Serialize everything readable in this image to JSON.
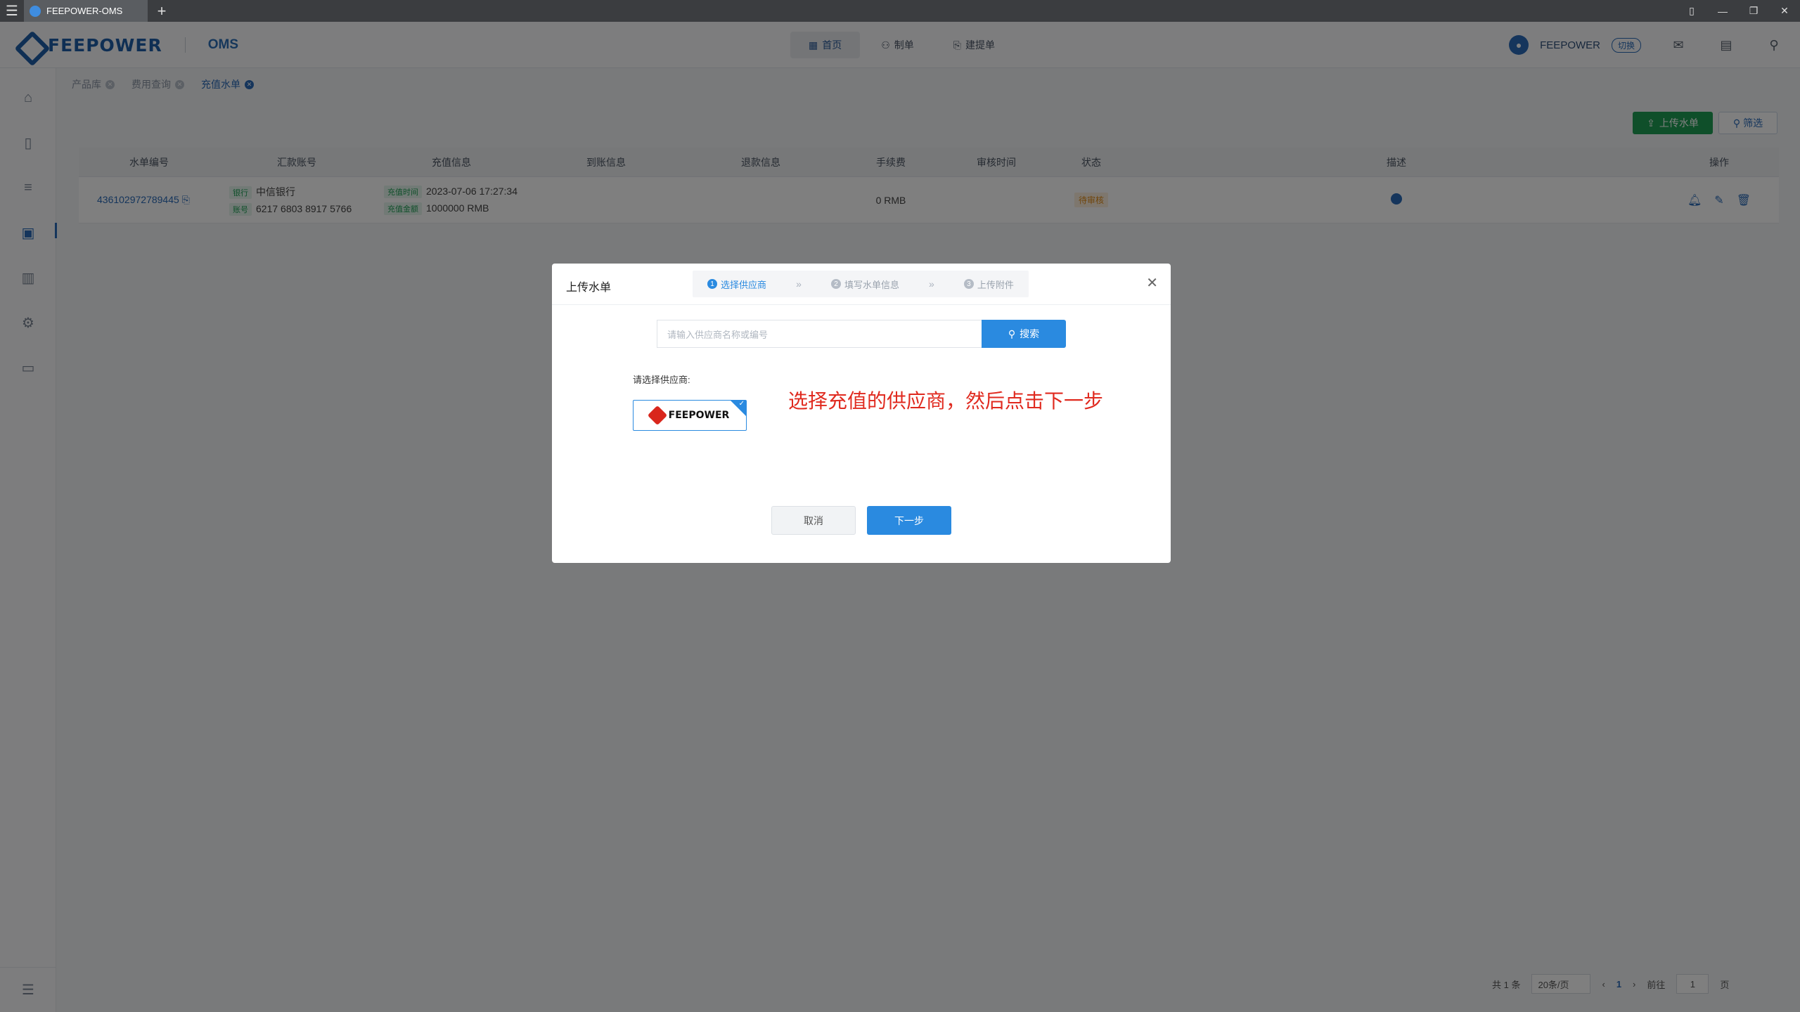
{
  "titlebar": {
    "tab_title": "FEEPOWER-OMS",
    "new_tab": "+",
    "window_controls": [
      "▯",
      "—",
      "❐",
      "✕"
    ]
  },
  "header": {
    "brand": "FEEPOWER",
    "product": "OMS",
    "nav": [
      {
        "label": "首页",
        "icon": "grid-icon",
        "active": true
      },
      {
        "label": "制单",
        "icon": "user-doc-icon",
        "active": false
      },
      {
        "label": "建提单",
        "icon": "doc-plus-icon",
        "active": false
      }
    ],
    "user_name": "FEEPOWER",
    "switch_label": "切换"
  },
  "breadcrumbs": [
    {
      "label": "产品库",
      "active": false
    },
    {
      "label": "费用查询",
      "active": false
    },
    {
      "label": "充值水单",
      "active": true
    }
  ],
  "toolbar": {
    "upload_label": "上传水单",
    "filter_label": "筛选"
  },
  "table": {
    "headers": [
      "水单编号",
      "汇款账号",
      "充值信息",
      "到账信息",
      "退款信息",
      "手续费",
      "审核时间",
      "状态",
      "描述",
      "操作"
    ],
    "rows": [
      {
        "id": "436102972789445",
        "bank_tag": "银行",
        "bank": "中信银行",
        "account_tag": "账号",
        "account": "6217 6803 8917 5766",
        "time_tag": "充值时间",
        "time": "2023-07-06 17:27:34",
        "amount_tag": "充值金额",
        "amount": "1000000 RMB",
        "fee": "0 RMB",
        "status": "待审核"
      }
    ]
  },
  "pagination": {
    "total": "共 1 条",
    "page_size": "20条/页",
    "current": "1",
    "goto_label": "前往",
    "goto_value": "1",
    "page_suffix": "页"
  },
  "modal": {
    "title": "上传水单",
    "steps": [
      {
        "num": "1",
        "label": "选择供应商",
        "active": true
      },
      {
        "num": "2",
        "label": "填写水单信息",
        "active": false
      },
      {
        "num": "3",
        "label": "上传附件",
        "active": false
      }
    ],
    "search_placeholder": "请输入供应商名称或编号",
    "search_button": "搜索",
    "choose_label": "请选择供应商:",
    "vendor_name": "FEEPOWER",
    "hint": "选择充值的供应商，然后点击下一步",
    "cancel_label": "取消",
    "next_label": "下一步"
  },
  "colors": {
    "primary": "#2a8ae0",
    "brand": "#1f5fa8",
    "success": "#1e9f55",
    "warning": "#e08a16",
    "hint": "#e02a1f"
  }
}
